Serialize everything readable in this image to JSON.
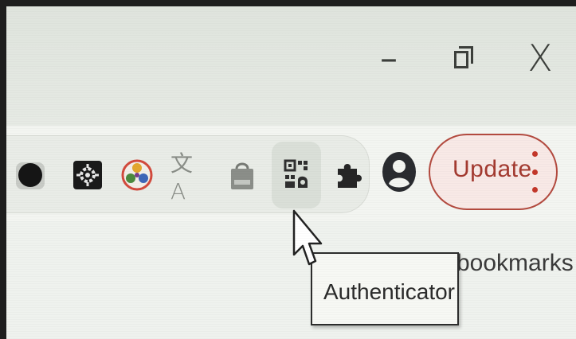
{
  "window_controls": {
    "minimize_label": "–",
    "close_label": "X"
  },
  "toolbar": {
    "extensions": [
      {
        "name": "dark-circle-extension",
        "icon": "dark-circle-icon"
      },
      {
        "name": "gear-extension",
        "icon": "gear-icon"
      },
      {
        "name": "color-wheel-extension",
        "icon": "color-wheel-icon"
      },
      {
        "name": "translate-extension",
        "icon": "translate-icon",
        "glyph": "文A"
      },
      {
        "name": "shopping-bag-extension",
        "icon": "shopping-bag-icon"
      },
      {
        "name": "authenticator-extension",
        "icon": "qr-code-icon"
      }
    ],
    "extensions_menu_icon": "puzzle-icon",
    "profile_icon": "profile-icon",
    "update_button": {
      "label": "Update",
      "border_color": "#b34a3f",
      "text_color": "#a33a30"
    }
  },
  "bookmarks_bar": {
    "label": "bookmarks"
  },
  "tooltip": {
    "text": "Authenticator"
  }
}
